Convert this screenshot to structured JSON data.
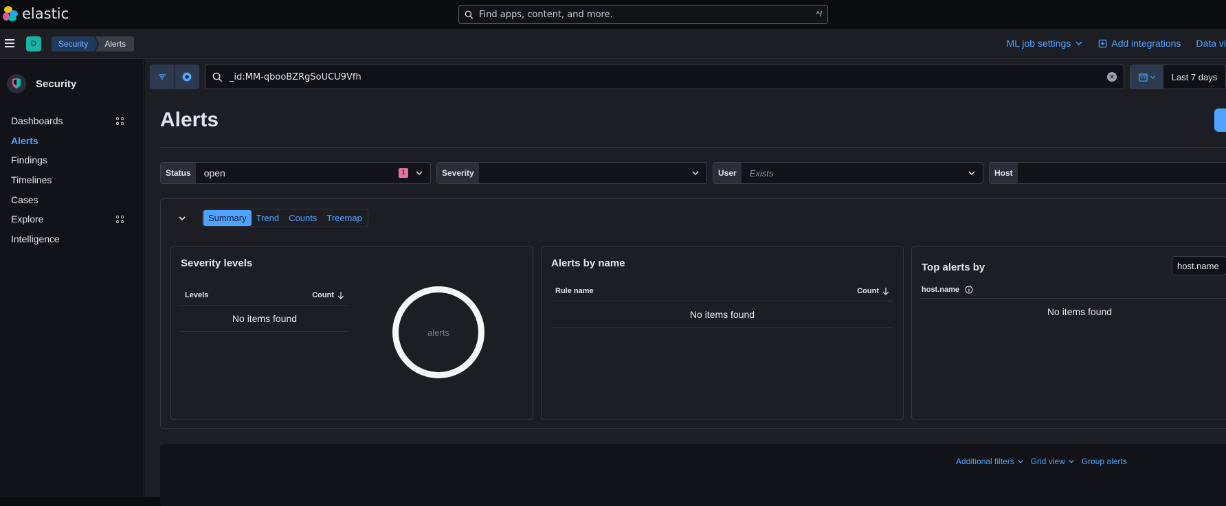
{
  "app": {
    "logo_text": "elastic"
  },
  "global_search": {
    "placeholder": "Find apps, content, and more.",
    "shortcut": "^/"
  },
  "space": {
    "initial": "D"
  },
  "breadcrumbs": [
    "Security",
    "Alerts"
  ],
  "header_links": {
    "ml_job_settings": "ML job settings",
    "add_integrations": "Add integrations",
    "data_view": "Data vi"
  },
  "sidebar": {
    "title": "Security",
    "items": [
      {
        "label": "Dashboards",
        "active": false,
        "grid_icon": true
      },
      {
        "label": "Alerts",
        "active": true,
        "grid_icon": false
      },
      {
        "label": "Findings",
        "active": false,
        "grid_icon": false
      },
      {
        "label": "Timelines",
        "active": false,
        "grid_icon": false
      },
      {
        "label": "Cases",
        "active": false,
        "grid_icon": false
      },
      {
        "label": "Explore",
        "active": false,
        "grid_icon": true
      },
      {
        "label": "Intelligence",
        "active": false,
        "grid_icon": false
      }
    ]
  },
  "query": {
    "value": "_id:MM-qbooBZRgSoUCU9Vfh",
    "date_range": "Last 7 days"
  },
  "page": {
    "title": "Alerts"
  },
  "filters": {
    "status": {
      "label": "Status",
      "value": "open",
      "count": "1"
    },
    "severity": {
      "label": "Severity",
      "value": ""
    },
    "user": {
      "label": "User",
      "placeholder": "Exists"
    },
    "host": {
      "label": "Host",
      "value": ""
    }
  },
  "summary": {
    "tabs": [
      "Summary",
      "Trend",
      "Counts",
      "Treemap"
    ],
    "selected_tab": "Summary",
    "severity_panel": {
      "title": "Severity levels",
      "col_levels": "Levels",
      "col_count": "Count",
      "empty": "No items found",
      "donut_label": "alerts"
    },
    "name_panel": {
      "title": "Alerts by name",
      "col_rule": "Rule name",
      "col_count": "Count",
      "empty": "No items found"
    },
    "top_panel": {
      "title": "Top alerts by",
      "group_value": "host.name",
      "col_field": "host.name",
      "empty": "No items found"
    }
  },
  "table_options": {
    "additional_filters": "Additional filters",
    "grid_view": "Grid view",
    "group_alerts": "Group alerts"
  },
  "colors": {
    "accent": "#4da3ff",
    "space_badge": "#18b3a5",
    "count_badge": "#e5729a"
  }
}
